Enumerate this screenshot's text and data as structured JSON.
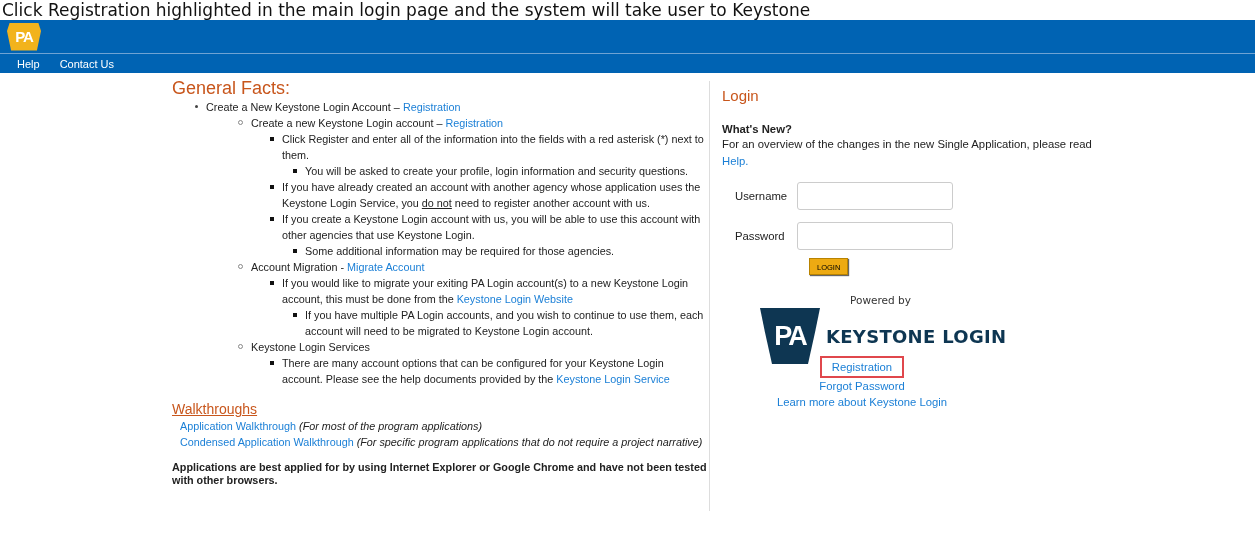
{
  "caption": "Click Registration highlighted in the main login page and the system will take user to Keystone",
  "header": {
    "logo": "PA",
    "nav": [
      {
        "label": "Help"
      },
      {
        "label": "Contact Us"
      }
    ]
  },
  "facts": {
    "title": "General Facts:",
    "items": [
      {
        "parts": [
          {
            "kind": "text",
            "text": "Create a New Keystone Login Account – "
          },
          {
            "kind": "link",
            "text": "Registration"
          }
        ],
        "children": [
          {
            "parts": [
              {
                "kind": "text",
                "text": "Create a new Keystone Login account – "
              },
              {
                "kind": "link",
                "text": "Registration"
              }
            ],
            "children": [
              {
                "parts": [
                  {
                    "kind": "text",
                    "text": "Click Register and enter all of the information into the fields with a red asterisk (*) next to them."
                  }
                ],
                "children": [
                  {
                    "parts": [
                      {
                        "kind": "text",
                        "text": "You will be asked to create your profile, login information and security questions."
                      }
                    ]
                  }
                ]
              },
              {
                "parts": [
                  {
                    "kind": "text",
                    "text": "If you have already created an account with another agency whose application uses the Keystone Login Service, you "
                  },
                  {
                    "kind": "underline",
                    "text": "do not"
                  },
                  {
                    "kind": "text",
                    "text": " need to register another account with us."
                  }
                ]
              },
              {
                "parts": [
                  {
                    "kind": "text",
                    "text": "If you create a Keystone Login account with us, you will be able to use this account with other agencies that use Keystone Login."
                  }
                ],
                "children": [
                  {
                    "parts": [
                      {
                        "kind": "text",
                        "text": "Some additional information may be required for those agencies."
                      }
                    ]
                  }
                ]
              }
            ]
          },
          {
            "parts": [
              {
                "kind": "text",
                "text": "Account Migration - "
              },
              {
                "kind": "link",
                "text": "Migrate Account"
              }
            ],
            "children": [
              {
                "parts": [
                  {
                    "kind": "text",
                    "text": "If you would like to migrate your exiting PA Login account(s) to a new Keystone Login account, this must be done from the "
                  },
                  {
                    "kind": "link",
                    "text": "Keystone Login Website"
                  }
                ],
                "children": [
                  {
                    "parts": [
                      {
                        "kind": "text",
                        "text": "If you have multiple PA Login accounts, and you wish to continue to use them, each account will need to be migrated to Keystone Login account."
                      }
                    ]
                  }
                ]
              }
            ]
          },
          {
            "parts": [
              {
                "kind": "text",
                "text": "Keystone Login Services"
              }
            ],
            "children": [
              {
                "parts": [
                  {
                    "kind": "text",
                    "text": "There are many account options that can be configured for your Keystone Login account. Please see the help documents provided by the "
                  },
                  {
                    "kind": "link",
                    "text": "Keystone Login Service"
                  }
                ]
              }
            ]
          }
        ]
      }
    ]
  },
  "walkthroughs": {
    "title": "Walkthroughs",
    "items": [
      {
        "link": "Application Walkthrough",
        "note": "(For most of the program applications)"
      },
      {
        "link": "Condensed Application Walkthrough",
        "note": "(For specific program applications that do not require a project narrative)"
      }
    ]
  },
  "browser_note": "Applications are best applied for by using Internet Explorer or Google Chrome and have not been tested with other browsers.",
  "login": {
    "title": "Login",
    "whats_new": {
      "heading": "What's New?",
      "text": "For an overview of the changes in the new Single Application, please read",
      "link": "Help."
    },
    "fields": [
      {
        "label": "Username"
      },
      {
        "label": "Password"
      }
    ],
    "button": "LOGIN",
    "powered_by": "Powered by",
    "logo": {
      "mark": "PA",
      "text": "KEYSTONE LOGIN"
    },
    "links": [
      {
        "label": "Registration",
        "highlighted": true
      },
      {
        "label": "Forgot Password",
        "highlighted": false
      },
      {
        "label": "Learn more about Keystone Login",
        "highlighted": false
      }
    ]
  }
}
